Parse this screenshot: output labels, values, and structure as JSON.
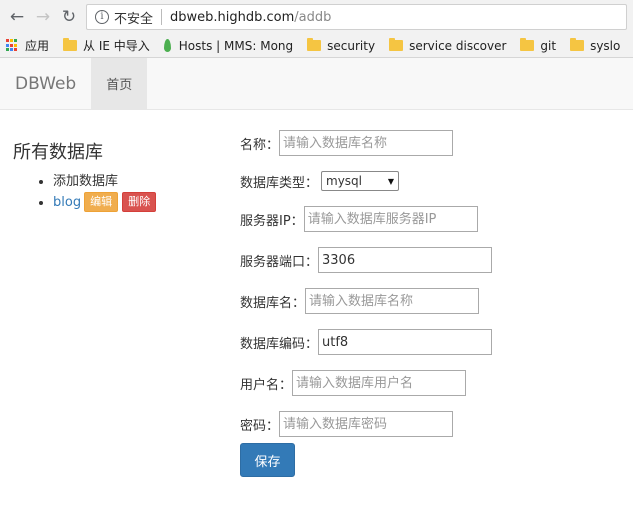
{
  "browser": {
    "security_label": "不安全",
    "url_host": "dbweb.highdb.com",
    "url_path": "/addb",
    "bookmarks": [
      {
        "label": "应用",
        "icon": "apps-icon"
      },
      {
        "label": "从 IE 中导入",
        "icon": "folder-icon"
      },
      {
        "label": "Hosts | MMS: Mong",
        "icon": "leaf-icon"
      },
      {
        "label": "security",
        "icon": "folder-icon"
      },
      {
        "label": "service discover",
        "icon": "folder-icon"
      },
      {
        "label": "git",
        "icon": "folder-icon"
      },
      {
        "label": "syslo",
        "icon": "folder-icon"
      }
    ]
  },
  "navbar": {
    "brand": "DBWeb",
    "home": "首页"
  },
  "sidebar": {
    "title": "所有数据库",
    "add_db": "添加数据库",
    "db_name": "blog",
    "edit_label": "编辑",
    "delete_label": "删除"
  },
  "form": {
    "name_label": "名称：",
    "name_placeholder": "请输入数据库名称",
    "type_label": "数据库类型：",
    "type_value": "mysql",
    "server_ip_label": "服务器IP：",
    "server_ip_placeholder": "请输入数据库服务器IP",
    "port_label": "服务器端口：",
    "port_value": "3306",
    "db_name_label": "数据库名：",
    "db_name_placeholder": "请输入数据库名称",
    "charset_label": "数据库编码：",
    "charset_value": "utf8",
    "user_label": "用户名：",
    "user_placeholder": "请输入数据库用户名",
    "password_label": "密码：",
    "password_placeholder": "请输入数据库密码",
    "save_label": "保存"
  },
  "colors": {
    "primary": "#337ab7",
    "warning": "#f0ad4e",
    "danger": "#d9534f"
  }
}
